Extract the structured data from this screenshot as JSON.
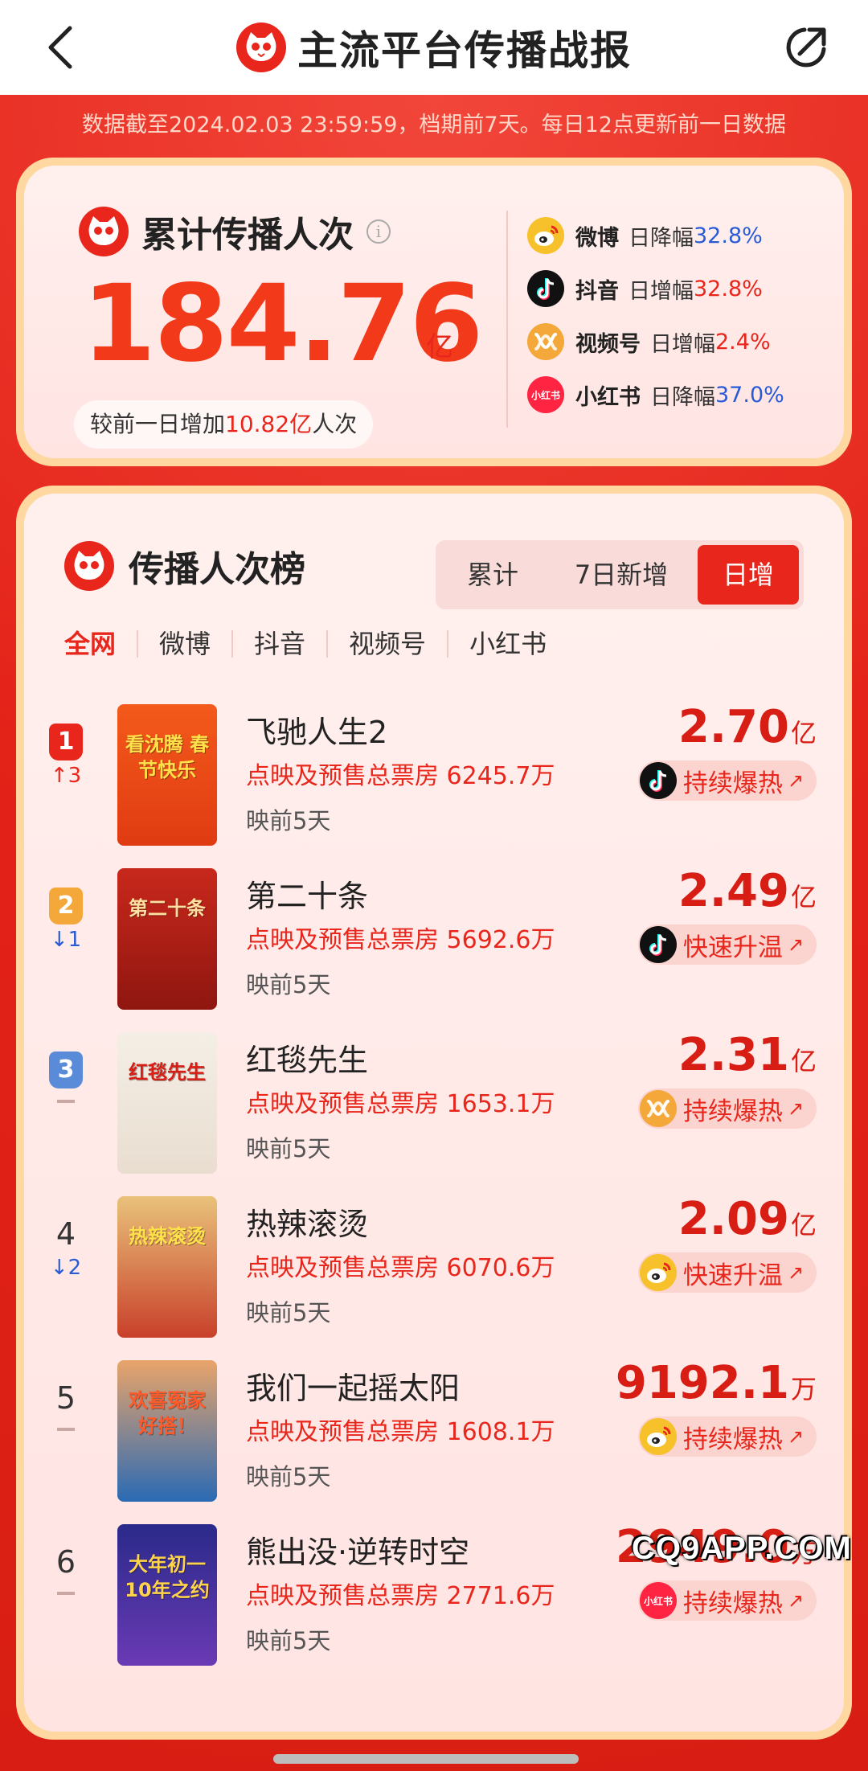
{
  "header": {
    "title": "主流平台传播战报"
  },
  "notice": "数据截至2024.02.03 23:59:59，档期前7天。每日12点更新前一日数据",
  "summary": {
    "title": "累计传播人次",
    "total": "184.76",
    "unit": "亿",
    "increase_prefix": "较前一日增加",
    "increase_value": "10.82亿",
    "increase_suffix": "人次",
    "platforms": [
      {
        "name": "微博",
        "desc": "日降幅",
        "value": "32.8%",
        "icon": "weibo-icon",
        "value_color": "#2a5bd7"
      },
      {
        "name": "抖音",
        "desc": "日增幅",
        "value": "32.8%",
        "icon": "douyin-icon",
        "value_color": "#e8261c"
      },
      {
        "name": "视频号",
        "desc": "日增幅",
        "value": "2.4%",
        "icon": "channels-icon",
        "value_color": "#e8261c"
      },
      {
        "name": "小红书",
        "desc": "日降幅",
        "value": "37.0%",
        "icon": "xiaohongshu-icon",
        "value_color": "#2a5bd7"
      }
    ]
  },
  "ranking": {
    "title": "传播人次榜",
    "segments": [
      "累计",
      "7日新增",
      "日增"
    ],
    "active_segment": "日增",
    "tabs": [
      "全网",
      "微博",
      "抖音",
      "视频号",
      "小红书"
    ],
    "active_tab": "全网",
    "items": [
      {
        "rank": "1",
        "change": "↑3",
        "change_dir": "up",
        "title": "飞驰人生2",
        "box": "点映及预售总票房 6245.7万",
        "days": "映前5天",
        "value": "2.70",
        "unit": "亿",
        "trend": "持续爆热",
        "platform_icon": "douyin-icon",
        "poster_text": "看沈腾 春节快乐"
      },
      {
        "rank": "2",
        "change": "↓1",
        "change_dir": "down",
        "title": "第二十条",
        "box": "点映及预售总票房 5692.6万",
        "days": "映前5天",
        "value": "2.49",
        "unit": "亿",
        "trend": "快速升温",
        "platform_icon": "douyin-icon",
        "poster_text": "第二十条"
      },
      {
        "rank": "3",
        "change": "",
        "change_dir": "flat",
        "title": "红毯先生",
        "box": "点映及预售总票房 1653.1万",
        "days": "映前5天",
        "value": "2.31",
        "unit": "亿",
        "trend": "持续爆热",
        "platform_icon": "channels-icon",
        "poster_text": "红毯先生"
      },
      {
        "rank": "4",
        "change": "↓2",
        "change_dir": "down",
        "title": "热辣滚烫",
        "box": "点映及预售总票房 6070.6万",
        "days": "映前5天",
        "value": "2.09",
        "unit": "亿",
        "trend": "快速升温",
        "platform_icon": "weibo-icon",
        "poster_text": "热辣滚烫"
      },
      {
        "rank": "5",
        "change": "",
        "change_dir": "flat",
        "title": "我们一起摇太阳",
        "box": "点映及预售总票房 1608.1万",
        "days": "映前5天",
        "value": "9192.1",
        "unit": "万",
        "trend": "持续爆热",
        "platform_icon": "weibo-icon",
        "poster_text": "欢喜冤家 好搭！"
      },
      {
        "rank": "6",
        "change": "",
        "change_dir": "flat",
        "title": "熊出没·逆转时空",
        "box": "点映及预售总票房 2771.6万",
        "days": "映前5天",
        "value": "2949.0",
        "unit": "万",
        "trend": "持续爆热",
        "platform_icon": "xiaohongshu-icon",
        "poster_text": "大年初一 10年之约"
      }
    ]
  },
  "watermark": "CQ9APP.COM"
}
